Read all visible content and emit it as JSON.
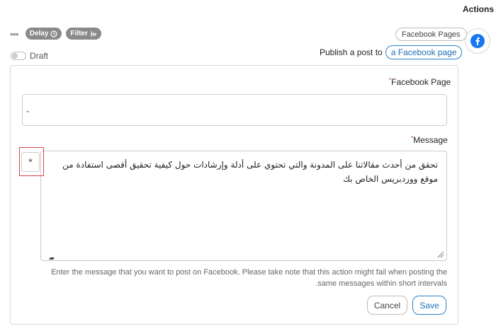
{
  "sidebar": {
    "title": "Actions",
    "facebook_icon": "facebook-icon",
    "facebook_color": "#1877f2"
  },
  "toolbar": {
    "more_icon": "more-dots-icon",
    "delay_label": "Delay",
    "delay_icon": "clock-icon",
    "filter_label": "Filter",
    "filter_icon": "filter-branch-icon"
  },
  "app_pill": "Facebook Pages",
  "draft": {
    "label": "Draft",
    "enabled": false
  },
  "publish": {
    "prefix": "Publish a post to",
    "link": "a Facebook page"
  },
  "form": {
    "page_label": "Facebook Page",
    "page_value": "",
    "message_label": "Message",
    "required_mark": "*",
    "insert_button": "*",
    "message_value": "تحقق من أحدث مقالاتنا على المدونة والتي تحتوي على أدلة وإرشادات حول كيفية تحقيق أقصى استفادة من موقع ووردبريس الخاص بك",
    "help_text": "Enter the message that you want to post on Facebook. Please take note that this action might fail when posting the same messages within short intervals."
  },
  "buttons": {
    "cancel": "Cancel",
    "save": "Save"
  },
  "colors": {
    "accent": "#2a82c7",
    "pill_gray": "#8a8a8a",
    "highlight": "#d64545"
  }
}
